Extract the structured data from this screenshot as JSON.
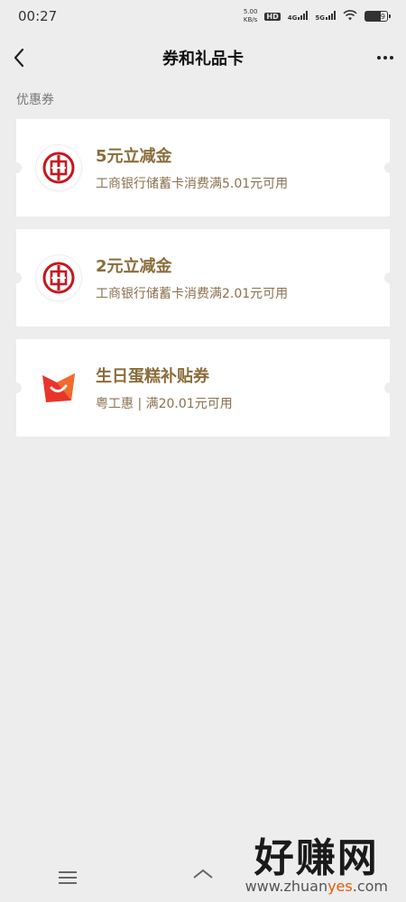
{
  "status_bar": {
    "time": "00:27",
    "net_speed_value": "5.00",
    "net_speed_unit": "KB/s",
    "hd": "HD",
    "signal1": "4G",
    "signal2": "5G",
    "battery_level": "79"
  },
  "nav": {
    "title": "券和礼品卡"
  },
  "section": {
    "label": "优惠券"
  },
  "coupons": [
    {
      "title": "5元立减金",
      "desc": "工商银行储蓄卡消费满5.01元可用",
      "logo": "icbc-logo"
    },
    {
      "title": "2元立减金",
      "desc": "工商银行储蓄卡消费满2.01元可用",
      "logo": "icbc-logo"
    },
    {
      "title": "生日蛋糕补贴券",
      "desc": "粤工惠 | 满20.01元可用",
      "logo": "yuegonghui-logo"
    }
  ],
  "watermark": {
    "big": "好赚网",
    "small_prefix": "www.zhuan",
    "small_accent": "yes",
    "small_suffix": ".com"
  },
  "colors": {
    "coupon_title": "#8a6d3b",
    "icbc_red": "#c7161e",
    "background": "#ededed"
  }
}
